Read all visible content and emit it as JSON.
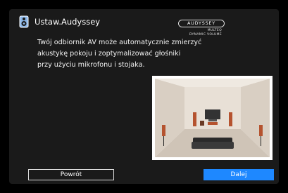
{
  "header": {
    "icon": "speaker-icon",
    "title": "Ustaw.Audyssey"
  },
  "brand": {
    "logo_text": "AUDYSSEY",
    "line1": "MULTEQ",
    "line2": "DYNAMIC VOLUME"
  },
  "description": {
    "lines": [
      "Twój odbiornik AV może automatycznie zmierzyć",
      "akustykę pokoju i zoptymalizować głośniki",
      "przy użyciu mikrofonu i stojaka."
    ]
  },
  "illustration": {
    "name": "room-speaker-setup-illustration"
  },
  "buttons": {
    "back": "Powrót",
    "next": "Dalej"
  },
  "colors": {
    "background": "#1a1a1a",
    "accent": "#1e88ff"
  }
}
